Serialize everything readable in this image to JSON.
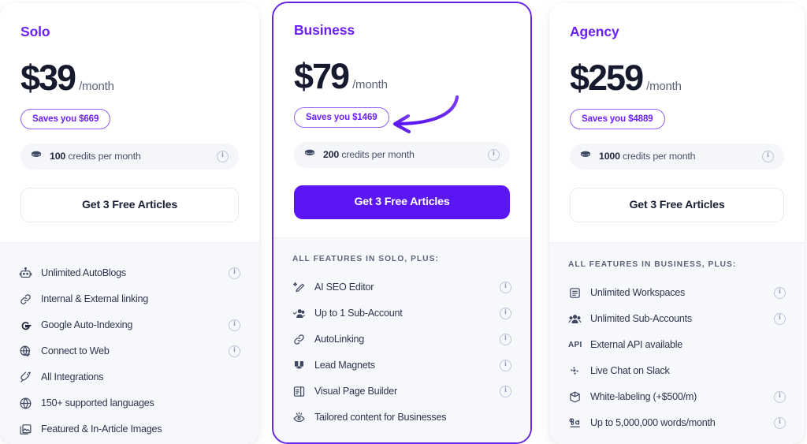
{
  "theme": {
    "accent_purple": "#6c20f5",
    "cta_purple": "#5b16f5",
    "badge_border": "#9463f7",
    "text_dark": "#151a2e",
    "section_bg": "#f7f8fb"
  },
  "plans": [
    {
      "id": "solo",
      "name": "Solo",
      "price": "$39",
      "period": "/month",
      "savings": "Saves you $669",
      "credits_amount": "100",
      "credits_suffix": "credits per month",
      "credits_icon": "coins-icon",
      "cta_label": "Get 3 Free Articles",
      "cta_style": "outline",
      "featured": false,
      "features_header": "",
      "features": [
        {
          "label": "Unlimited AutoBlogs",
          "icon": "robot-icon",
          "info": true
        },
        {
          "label": "Internal & External linking",
          "icon": "link-chain-icon",
          "info": false
        },
        {
          "label": "Google Auto-Indexing",
          "icon": "google-g-icon",
          "info": true
        },
        {
          "label": "Connect to Web",
          "icon": "globe-check-icon",
          "info": true
        },
        {
          "label": "All Integrations",
          "icon": "plug-icon",
          "info": false
        },
        {
          "label": "150+ supported languages",
          "icon": "globe-icon",
          "info": false
        },
        {
          "label": "Featured & In-Article Images",
          "icon": "images-icon",
          "info": false
        }
      ]
    },
    {
      "id": "business",
      "name": "Business",
      "price": "$79",
      "period": "/month",
      "savings": "Saves you $1469",
      "credits_amount": "200",
      "credits_suffix": "credits per month",
      "credits_icon": "coins-icon",
      "cta_label": "Get 3 Free Articles",
      "cta_style": "filled",
      "featured": true,
      "features_header": "ALL FEATURES IN SOLO, PLUS:",
      "features": [
        {
          "label": "AI SEO Editor",
          "icon": "magic-pen-icon",
          "info": true
        },
        {
          "label": "Up to 1 Sub-Account",
          "icon": "users-check-icon",
          "info": true
        },
        {
          "label": "AutoLinking",
          "icon": "link-chain-icon",
          "info": true
        },
        {
          "label": "Lead Magnets",
          "icon": "magnet-icon",
          "info": true
        },
        {
          "label": "Visual Page Builder",
          "icon": "page-layout-icon",
          "info": true
        },
        {
          "label": "Tailored content for Businesses",
          "icon": "eye-sparkle-icon",
          "info": false
        }
      ]
    },
    {
      "id": "agency",
      "name": "Agency",
      "price": "$259",
      "period": "/month",
      "savings": "Saves you $4889",
      "credits_amount": "1000",
      "credits_suffix": "credits per month",
      "credits_icon": "coins-icon",
      "cta_label": "Get 3 Free Articles",
      "cta_style": "outline",
      "featured": false,
      "features_header": "ALL FEATURES IN BUSINESS, PLUS:",
      "features": [
        {
          "label": "Unlimited Workspaces",
          "icon": "workspace-icon",
          "info": true
        },
        {
          "label": "Unlimited Sub-Accounts",
          "icon": "users-icon",
          "info": true
        },
        {
          "label": "External API available",
          "icon": "api-text-icon",
          "info": false
        },
        {
          "label": "Live Chat on Slack",
          "icon": "slack-icon",
          "info": false
        },
        {
          "label": "White-labeling (+$500/m)",
          "icon": "box-icon",
          "info": true
        },
        {
          "label": "Up to 5,000,000 words/month",
          "icon": "ab-words-icon",
          "info": true
        }
      ]
    }
  ],
  "annotation": {
    "type": "curved-arrow",
    "points_to": "business-savings-badge",
    "color": "#6524e8"
  }
}
